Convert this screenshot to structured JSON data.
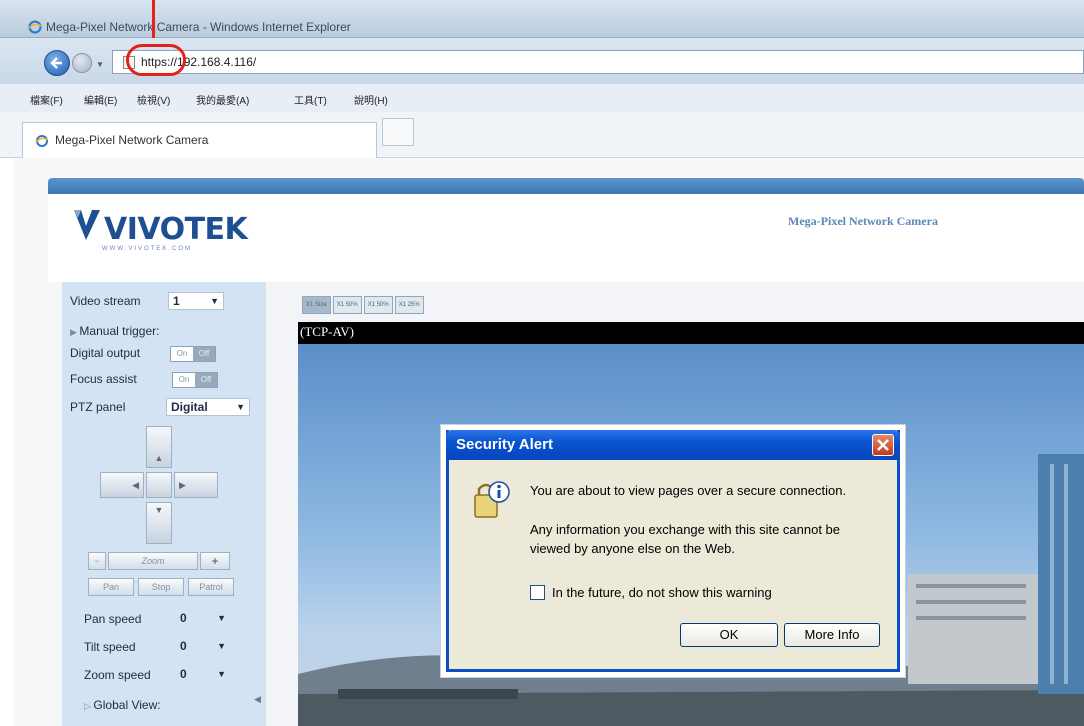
{
  "browser": {
    "window_title": "Mega-Pixel Network Camera - Windows Internet Explorer",
    "url": "https://192.168.4.116/",
    "menu": [
      "檔案(F)",
      "編輯(E)",
      "檢視(V)",
      "我的最愛(A)",
      "工具(T)",
      "說明(H)"
    ],
    "tab_label": "Mega-Pixel Network Camera"
  },
  "camera_page": {
    "logo": "VIVOTEK",
    "logo_sub": "WWW.VIVOTEK.COM",
    "title": "Mega-Pixel Network Camera",
    "sidebar": {
      "video_stream_label": "Video stream",
      "video_stream_value": "1",
      "manual_trigger": "Manual trigger",
      "digital_output_label": "Digital output",
      "focus_assist_label": "Focus assist",
      "toggle_on": "On",
      "toggle_off": "Off",
      "ptz_panel_label": "PTZ panel",
      "ptz_panel_value": "Digital",
      "zoom_label": "Zoom",
      "zoom_minus": "−",
      "zoom_plus": "+",
      "pan_button": "Pan",
      "stop_button": "Stop",
      "patrol_button": "Patrol",
      "pan_speed_label": "Pan speed",
      "pan_speed_value": "0",
      "tilt_speed_label": "Tilt speed",
      "tilt_speed_value": "0",
      "zoom_speed_label": "Zoom speed",
      "zoom_speed_value": "0",
      "global_view": "Global View"
    },
    "size_buttons": [
      "X1 Size",
      "X1 50%",
      "X1 50%",
      "X1 25%"
    ],
    "video_label": "(TCP-AV)"
  },
  "dialog": {
    "title": "Security Alert",
    "line1": "You are about to view pages over a secure connection.",
    "line2": "Any information you exchange with this site cannot be",
    "line3": "viewed by anyone else on the Web.",
    "checkbox_label": "In the future, do not show this warning",
    "ok_label": "OK",
    "more_info_label": "More Info"
  },
  "colors": {
    "highlight": "#e2231a",
    "xp_title_blue": "#0a52d0",
    "sidebar_bg": "#d4e3f3"
  }
}
